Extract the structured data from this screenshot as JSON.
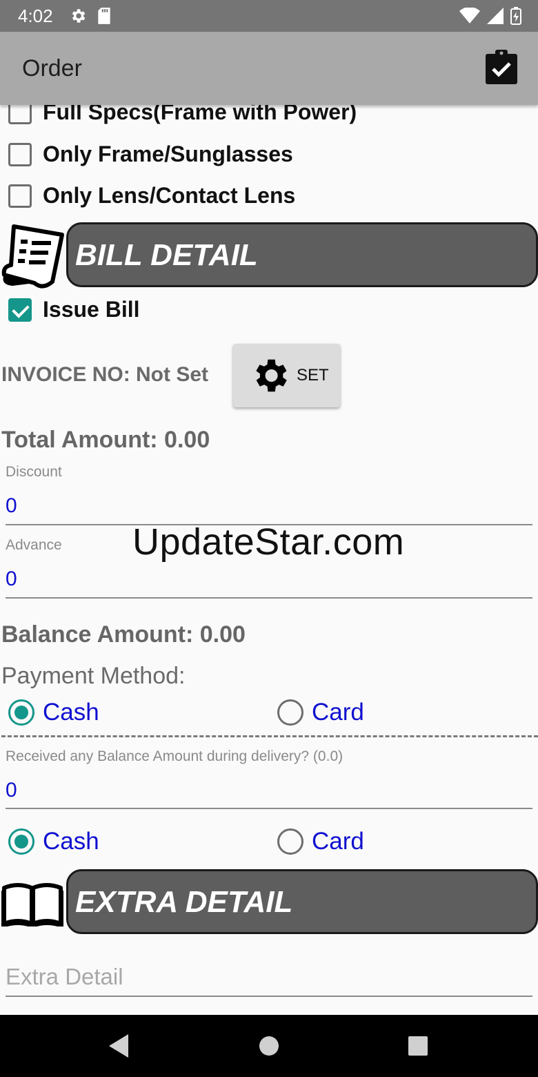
{
  "status": {
    "time": "4:02"
  },
  "appbar": {
    "title": "Order"
  },
  "checkboxes": [
    {
      "label": "Full Specs(Frame with Power)",
      "checked": false
    },
    {
      "label": "Only Frame/Sunglasses",
      "checked": false
    },
    {
      "label": "Only Lens/Contact Lens",
      "checked": false
    }
  ],
  "bill_detail": {
    "title": "BILL DETAIL",
    "issue_bill_label": "Issue Bill",
    "issue_bill_checked": true
  },
  "invoice": {
    "label": "INVOICE NO: Not Set",
    "set_button_label": "SET"
  },
  "total_amount": "Total Amount: 0.00",
  "discount": {
    "label": "Discount",
    "value": "0"
  },
  "advance": {
    "label": "Advance",
    "value": "0"
  },
  "watermark": "UpdateStar.com",
  "balance_amount": "Balance Amount: 0.00",
  "payment": {
    "label": "Payment Method:",
    "options": [
      "Cash",
      "Card"
    ],
    "selected": "Cash"
  },
  "delivery": {
    "label": "Received any Balance Amount during delivery? (0.0)",
    "value": "0",
    "options": [
      "Cash",
      "Card"
    ],
    "selected": "Cash"
  },
  "extra_detail": {
    "title": "EXTRA DETAIL",
    "placeholder": "Extra Detail"
  },
  "colors": {
    "accent": "#14968a",
    "value_text": "#1010d0",
    "header_bg": "#5e5e5e",
    "appbar_bg": "#a9a9a9"
  }
}
